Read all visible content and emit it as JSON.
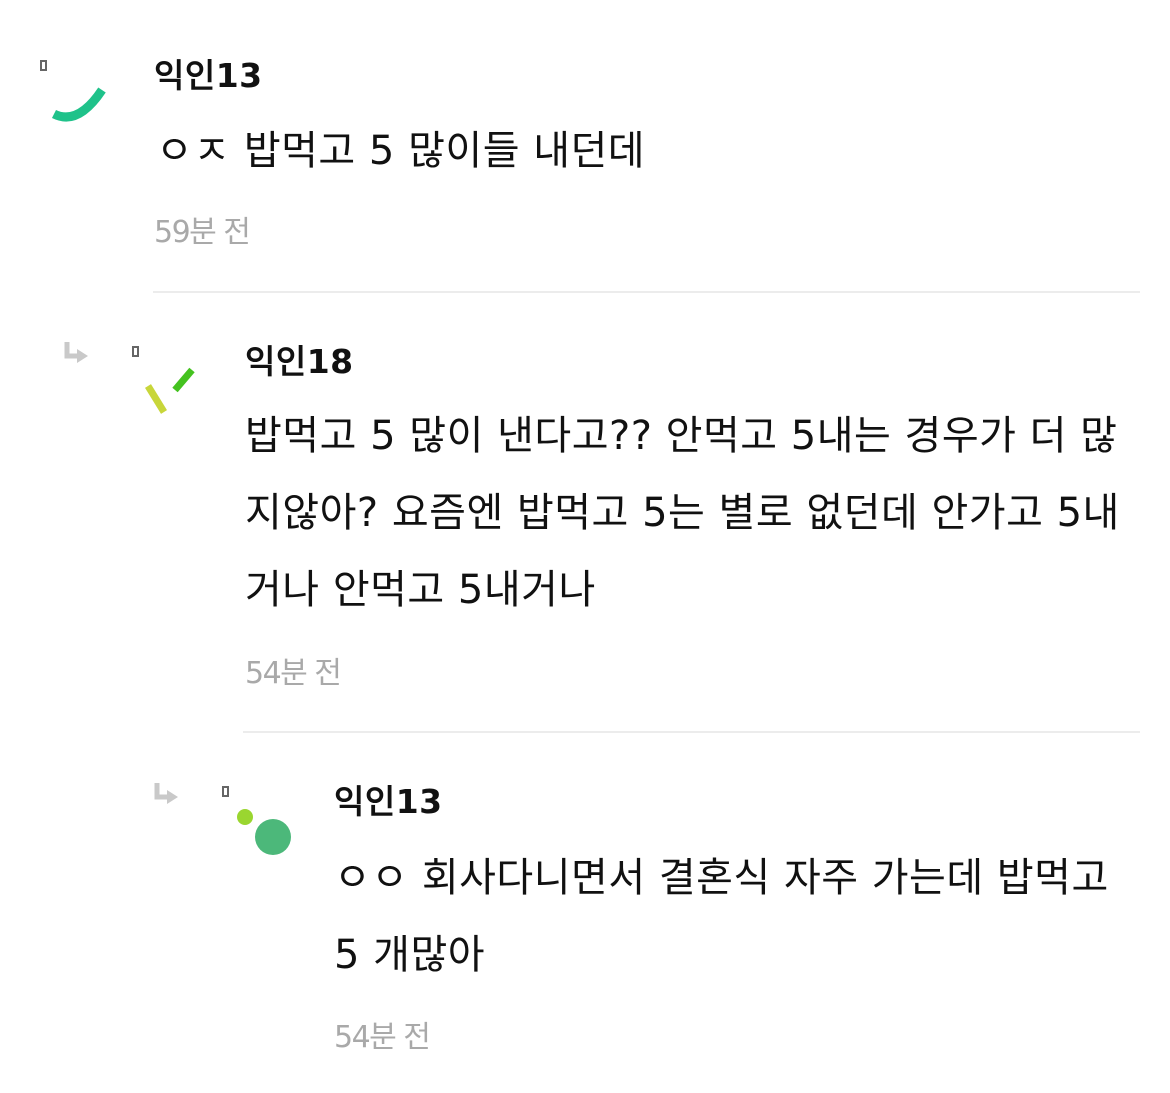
{
  "comments": [
    {
      "author": "익인13",
      "text": "ㅇㅈ 밥먹고 5 많이들 내던데",
      "time": "59분 전",
      "avatar_color": "#1fc28a"
    },
    {
      "author": "익인18",
      "text": "밥먹고 5 많이 낸다고?? 안먹고 5내는 경우가 더 많지않아? 요즘엔 밥먹고 5는 별로 없던데 안가고 5내거나 안먹고 5내거나",
      "time": "54분 전",
      "avatar_colors": [
        "#c8d63a",
        "#44c21f"
      ]
    },
    {
      "author": "익인13",
      "text": "ㅇㅇ 회사다니면서 결혼식 자주 가는데 밥먹고 5 개많아",
      "time": "54분 전",
      "avatar_colors": [
        "#9ad630",
        "#4cb87a"
      ]
    }
  ]
}
